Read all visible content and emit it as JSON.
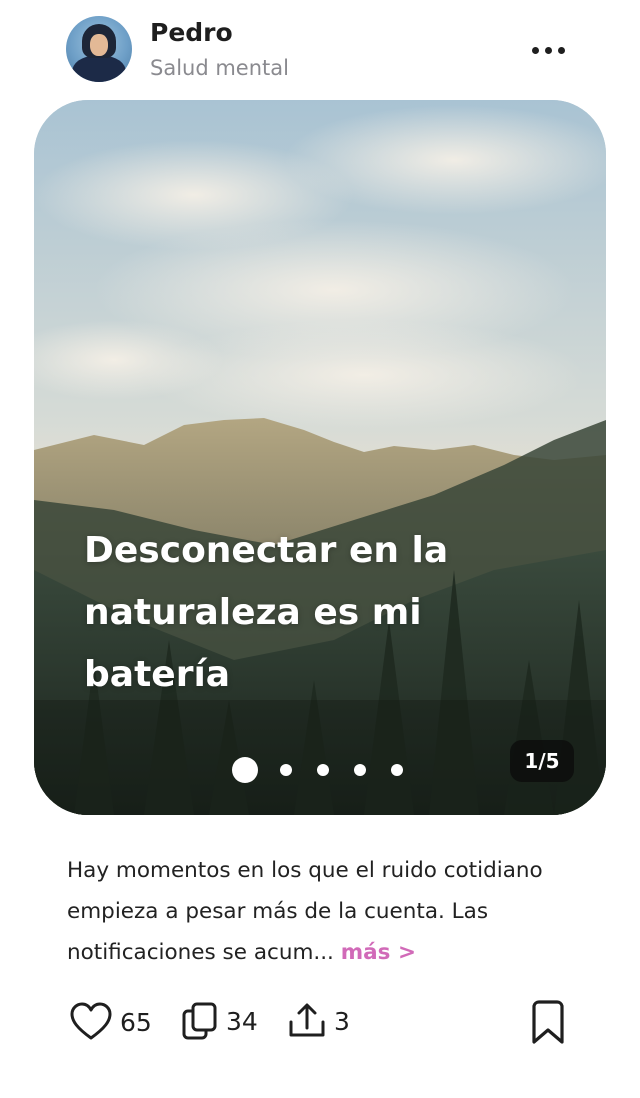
{
  "author": {
    "name": "Pedro",
    "topic": "Salud mental"
  },
  "post": {
    "overlay_text": "Desconectar en la naturaleza es mi batería",
    "page_indicator": "1/5",
    "slides_total": 5,
    "slide_current": 1,
    "caption": "Hay momentos en los que el ruido cotidiano empieza a pesar más de la cuenta. Las notificaciones se acum...",
    "more_label": "más >"
  },
  "stats": {
    "likes": "65",
    "collections": "34",
    "shares": "3"
  },
  "icons": {
    "more": "more-horizontal-icon",
    "like": "heart-icon",
    "collect": "copy-icon",
    "share": "share-icon",
    "save": "bookmark-icon"
  },
  "colors": {
    "accent": "#d16ab8",
    "text": "#1f1f1f",
    "muted": "#8a8a8f"
  }
}
